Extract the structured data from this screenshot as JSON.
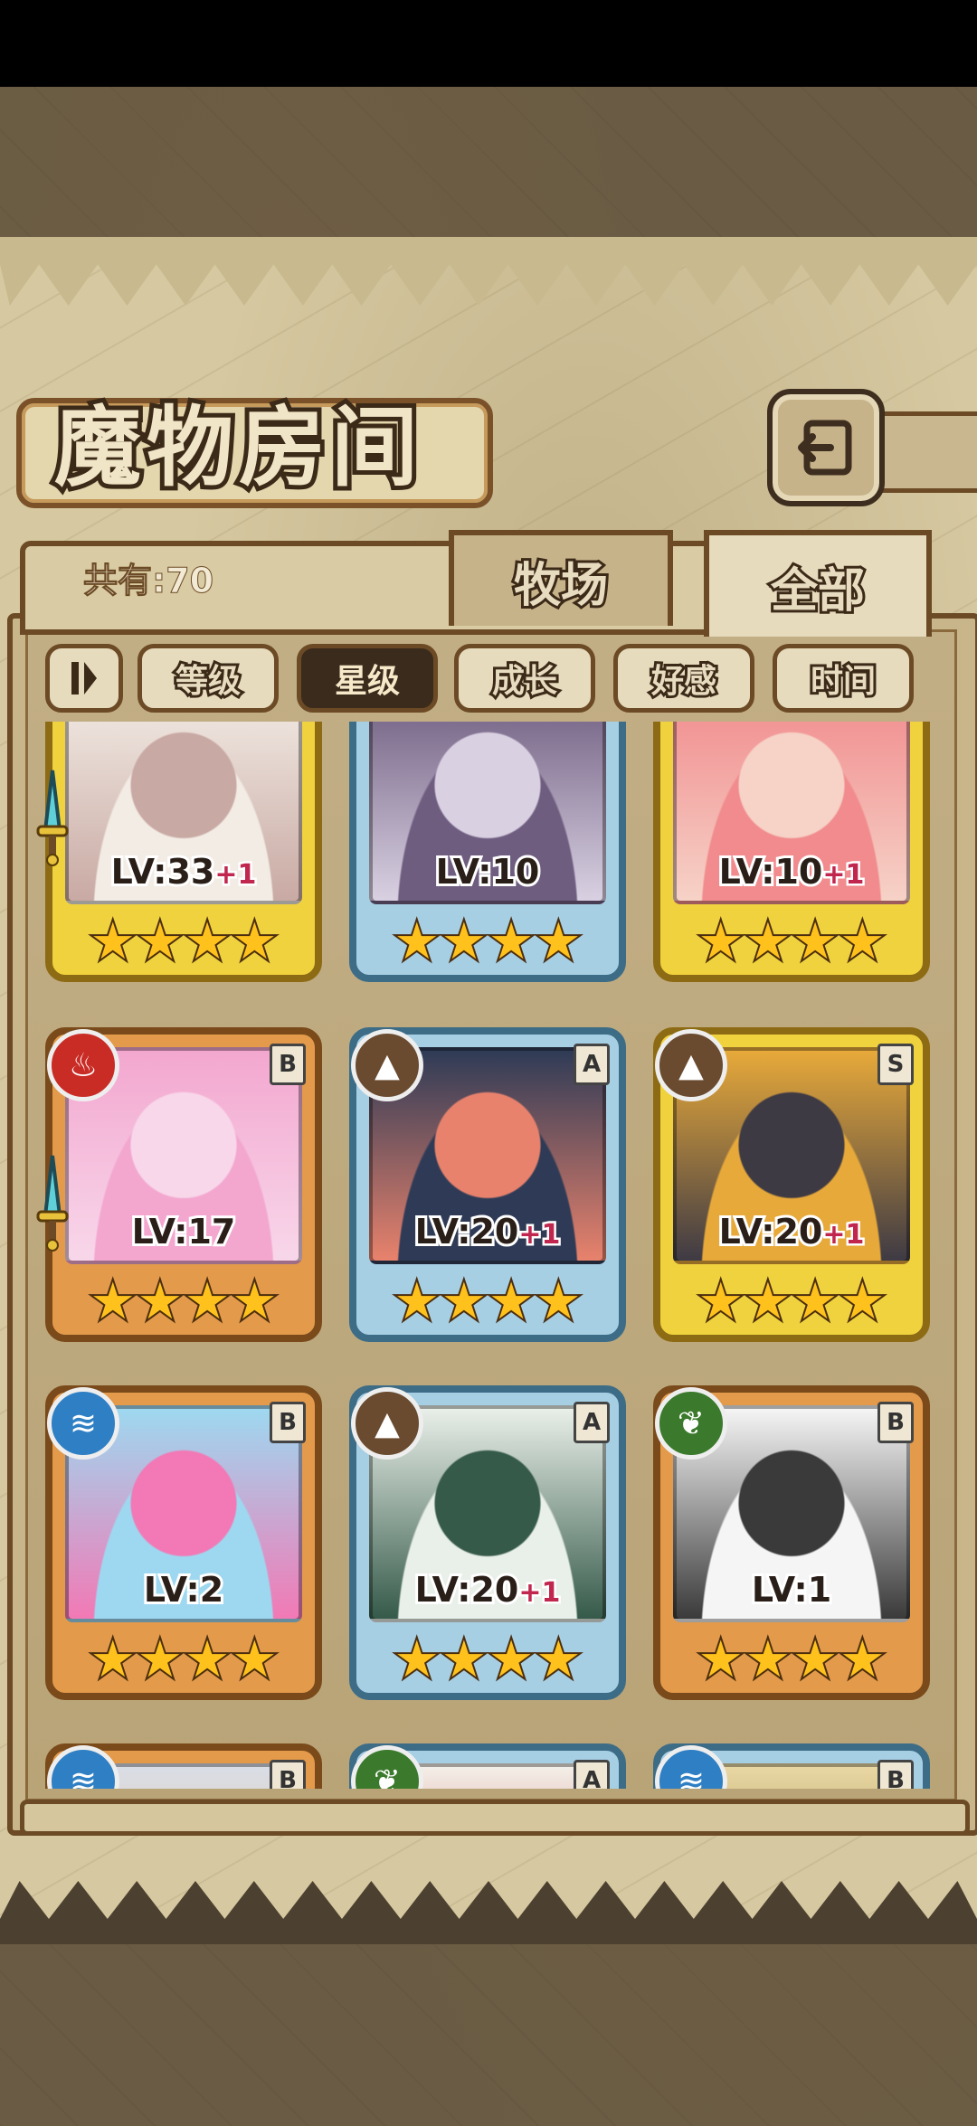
{
  "header": {
    "title": "魔物房间"
  },
  "count_label": "共有:70",
  "tabs": {
    "ranch": "牧场",
    "all": "全部"
  },
  "filters": [
    "等级",
    "星级",
    "成长",
    "好感",
    "时间"
  ],
  "active_filter": "星级",
  "cards": [
    {
      "level": "LV:33",
      "bonus": "+1",
      "stars": 4,
      "frame": "gold",
      "art": [
        "#f2ece5",
        "#c9a9a3"
      ]
    },
    {
      "level": "LV:10",
      "bonus": "",
      "stars": 4,
      "frame": "silver",
      "art": [
        "#6f5d80",
        "#d9d1e2"
      ]
    },
    {
      "level": "LV:10",
      "bonus": "+1",
      "stars": 4,
      "frame": "gold",
      "art": [
        "#f18b8d",
        "#f6d2c7"
      ]
    },
    {
      "level": "LV:17",
      "bonus": "",
      "stars": 4,
      "frame": "bronze",
      "rank": "B",
      "element": "fire",
      "art": [
        "#f3a7cf",
        "#f8d7ea"
      ]
    },
    {
      "level": "LV:20",
      "bonus": "+1",
      "stars": 4,
      "frame": "silver",
      "rank": "A",
      "element": "earth",
      "art": [
        "#2f3b56",
        "#e8826c"
      ]
    },
    {
      "level": "LV:20",
      "bonus": "+1",
      "stars": 4,
      "frame": "gold",
      "rank": "S",
      "element": "earth",
      "art": [
        "#e7a93a",
        "#3e3a44"
      ]
    },
    {
      "level": "LV:2",
      "bonus": "",
      "stars": 4,
      "frame": "bronze",
      "rank": "B",
      "element": "water",
      "art": [
        "#9ed8f0",
        "#f279b5"
      ]
    },
    {
      "level": "LV:20",
      "bonus": "+1",
      "stars": 4,
      "frame": "silver",
      "rank": "A",
      "element": "earth",
      "art": [
        "#e9efe9",
        "#355a4a"
      ]
    },
    {
      "level": "LV:1",
      "bonus": "",
      "stars": 4,
      "frame": "bronze",
      "rank": "B",
      "element": "wind",
      "art": [
        "#f5f5f5",
        "#3a3a3a"
      ]
    },
    {
      "level": "",
      "bonus": "",
      "stars": 0,
      "frame": "bronze",
      "rank": "B",
      "element": "water",
      "art": [
        "#d9dde6",
        "#f0c98b"
      ]
    },
    {
      "level": "",
      "bonus": "",
      "stars": 0,
      "frame": "silver",
      "rank": "A",
      "element": "wind",
      "art": [
        "#f3efe8",
        "#c74141"
      ]
    },
    {
      "level": "",
      "bonus": "",
      "stars": 0,
      "frame": "silver",
      "rank": "B",
      "element": "water",
      "art": [
        "#e8d7a2",
        "#8a6d3b"
      ]
    }
  ],
  "colors": {
    "gold_frame": "#f0d23e",
    "silver_frame": "#a7cfe4",
    "bronze_frame": "#e39a4b",
    "star": "#ffc21c"
  }
}
